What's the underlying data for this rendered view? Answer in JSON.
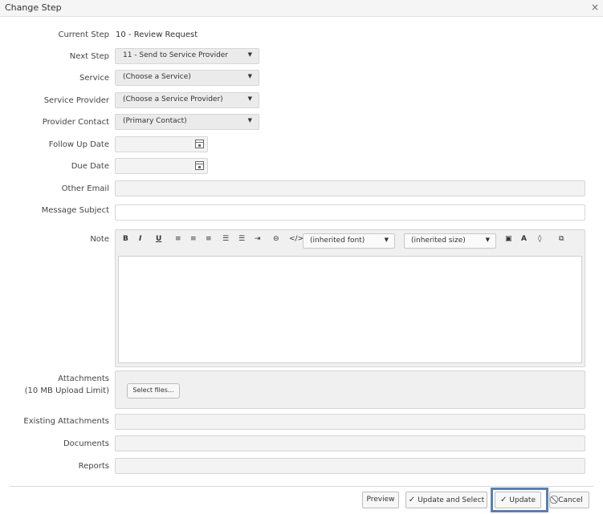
{
  "dialog": {
    "title": "Change Step",
    "close_glyph": "×"
  },
  "form": {
    "current_step": {
      "label": "Current Step",
      "value": "10 - Review Request"
    },
    "next_step": {
      "label": "Next Step",
      "value": "11 - Send to Service Provider"
    },
    "service": {
      "label": "Service",
      "value": "(Choose a Service)"
    },
    "service_provider": {
      "label": "Service Provider",
      "value": "(Choose a Service Provider)"
    },
    "provider_contact": {
      "label": "Provider Contact",
      "value": "(Primary Contact)"
    },
    "follow_up_date": {
      "label": "Follow Up Date",
      "value": ""
    },
    "due_date": {
      "label": "Due Date",
      "value": ""
    },
    "other_email": {
      "label": "Other Email",
      "value": ""
    },
    "message_subject": {
      "label": "Message Subject",
      "value": ""
    },
    "note": {
      "label": "Note",
      "value": ""
    },
    "attachments": {
      "label_line1": "Attachments",
      "label_line2": "(10 MB Upload Limit)",
      "select_files": "Select files..."
    },
    "existing_attachments": {
      "label": "Existing Attachments"
    },
    "documents": {
      "label": "Documents"
    },
    "reports": {
      "label": "Reports"
    }
  },
  "editor": {
    "bold": "B",
    "italic": "I",
    "underline": "U",
    "align_left": "≡",
    "align_center": "≡",
    "align_right": "≡",
    "bullet_list": "☰",
    "numbered_list": "☰",
    "indent": "⇥",
    "link": "⊖",
    "code": "</>",
    "font": "(inherited font)",
    "size": "(inherited size)",
    "image": "▣",
    "font_color": "A",
    "background_color": "◊",
    "view_html": "⧉",
    "caret": "▼"
  },
  "footer": {
    "preview": "Preview",
    "update_and_select": "Update and Select",
    "update": "Update",
    "cancel": "Cancel"
  },
  "colors": {
    "highlight": "#5c7fb0"
  }
}
